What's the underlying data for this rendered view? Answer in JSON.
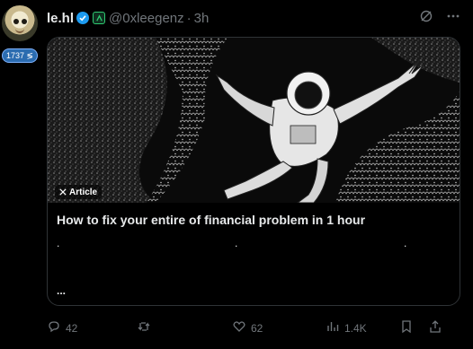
{
  "author": {
    "display_name": "le.hl",
    "handle": "@0xleegenz",
    "separator": "·",
    "time": "3h",
    "followers_badge": "1737 ≶"
  },
  "icons": {
    "avatar": "cartoon-avatar",
    "verified": "verified-check-icon",
    "affiliation": "green-affiliate-icon",
    "grok": "grok-icon",
    "more": "more-icon"
  },
  "card": {
    "tag": "Article",
    "title": "How to fix your entire of financial problem in 1 hour",
    "dots": [
      ".",
      ".",
      "."
    ],
    "ellipsis": "..."
  },
  "actions": {
    "replies": "42",
    "reposts": "",
    "likes": "62",
    "views": "1.4K"
  },
  "colors": {
    "background": "#000000",
    "text": "#e7e9ea",
    "muted": "#71767b",
    "verified": "#1d9bf0",
    "border": "#2f3336"
  }
}
